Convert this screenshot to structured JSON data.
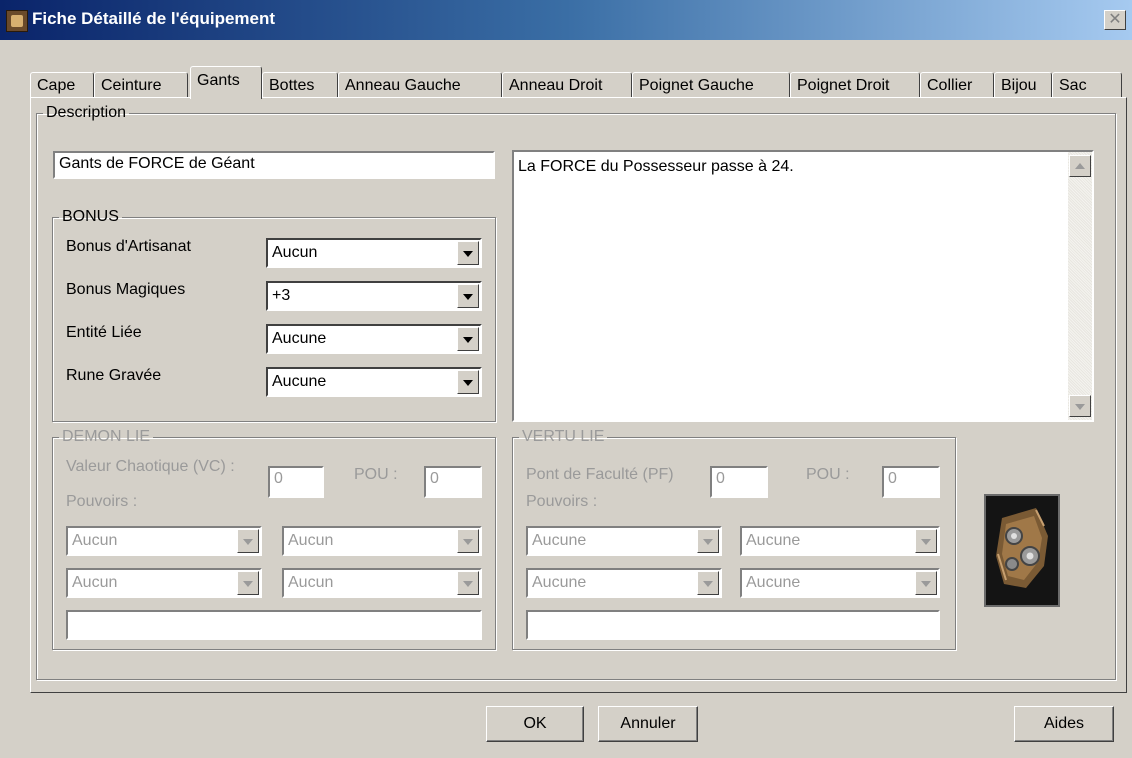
{
  "window": {
    "title": "Fiche Détaillé de l'équipement",
    "close_glyph": "✕"
  },
  "tabs": [
    {
      "label": "Cape"
    },
    {
      "label": "Ceinture"
    },
    {
      "label": "Gants",
      "active": true
    },
    {
      "label": "Bottes"
    },
    {
      "label": "Anneau Gauche"
    },
    {
      "label": "Anneau Droit"
    },
    {
      "label": "Poignet Gauche"
    },
    {
      "label": "Poignet Droit"
    },
    {
      "label": "Collier"
    },
    {
      "label": "Bijou"
    },
    {
      "label": "Sac"
    }
  ],
  "description": {
    "legend": "Description",
    "name_value": "Gants de FORCE de Géant",
    "text": "La FORCE du Possesseur passe à 24."
  },
  "bonus": {
    "legend": "BONUS",
    "rows": [
      {
        "label": "Bonus d'Artisanat",
        "value": "Aucun"
      },
      {
        "label": "Bonus Magiques",
        "value": "+3"
      },
      {
        "label": "Entité Liée",
        "value": "Aucune"
      },
      {
        "label": "Rune Gravée",
        "value": "Aucune"
      }
    ]
  },
  "demon": {
    "legend": "DEMON LIE",
    "vc_label": "Valeur Chaotique (VC) :",
    "vc_value": "0",
    "pou_label": "POU :",
    "pou_value": "0",
    "pouvoirs_label": "Pouvoirs :",
    "selects": [
      "Aucun",
      "Aucun",
      "Aucun",
      "Aucun"
    ],
    "text_value": ""
  },
  "vertu": {
    "legend": "VERTU LIE",
    "pf_label": "Pont de Faculté (PF)",
    "pf_value": "0",
    "pou_label": "POU :",
    "pou_value": "0",
    "pouvoirs_label": "Pouvoirs :",
    "selects": [
      "Aucune",
      "Aucune",
      "Aucune",
      "Aucune"
    ],
    "text_value": ""
  },
  "image": {
    "icon": "gauntlet-icon"
  },
  "buttons": {
    "ok": "OK",
    "cancel": "Annuler",
    "help": "Aides"
  }
}
